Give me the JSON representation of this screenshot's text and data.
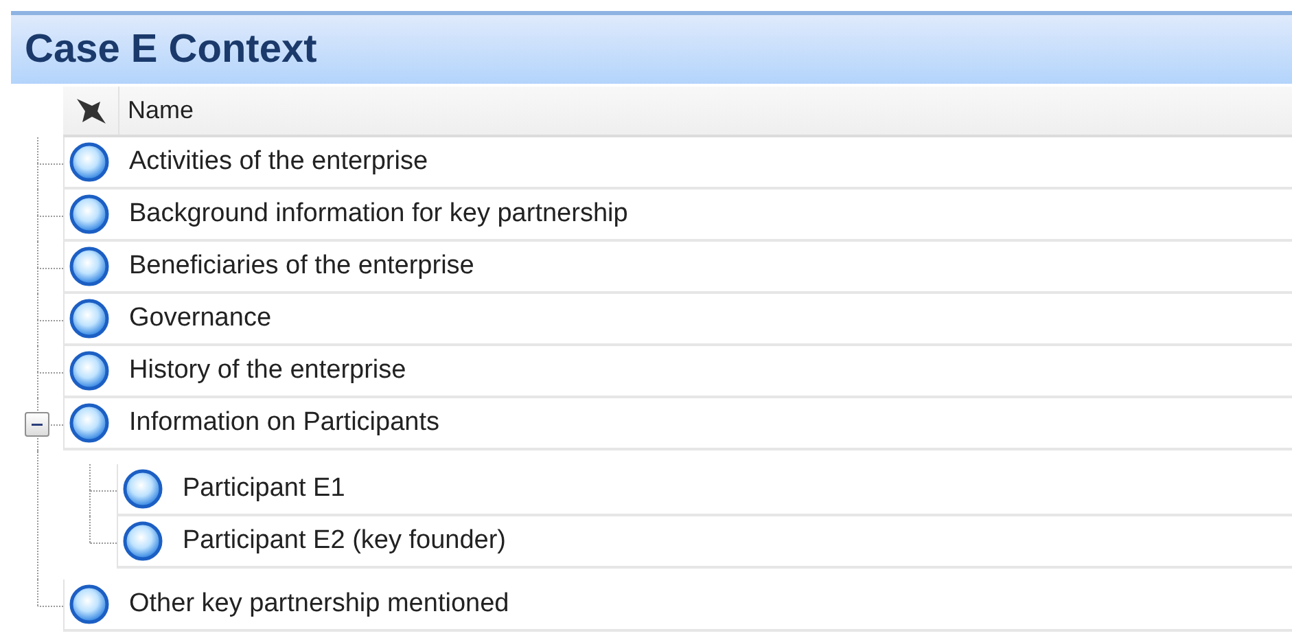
{
  "panel": {
    "title": "Case E Context"
  },
  "column_header": {
    "label": "Name"
  },
  "nodes": [
    {
      "label": "Activities of the enterprise"
    },
    {
      "label": "Background information for key partnership"
    },
    {
      "label": "Beneficiaries of the enterprise"
    },
    {
      "label": "Governance"
    },
    {
      "label": "History of the enterprise"
    },
    {
      "label": "Information on Participants",
      "expanded": true,
      "children": [
        {
          "label": "Participant E1"
        },
        {
          "label": "Participant E2 (key founder)"
        }
      ]
    },
    {
      "label": "Other key partnership mentioned"
    }
  ]
}
